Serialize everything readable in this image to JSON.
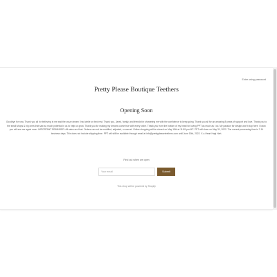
{
  "header": {
    "password_link": "Enter using password",
    "store_name": "Pretty Please Boutique Teethers"
  },
  "main": {
    "heading": "Opening Soon",
    "message": "Goodbye for now. Thank you all for believing in me and the crazy dream I had while on bed rest. Thank you, Jared, family, and friends for showering me with the confidence to keep going. Thank you all for an amazing 8 years of support and love. Thank you to the small shops & big ones that saw so much potential in us to help us grow. Thank you for making my dreams come true with every order. Thank you from the bottom of my heart for loving PPT as much as I do. My passion for design won't stop here. I know you will see me again soon. IMPORTANT REMINDER: All sales are final. Orders can not be modified, adjusted, or cancel. Online shopping will be closed on May 15th at 11:59 pm MT. PPT will close on May 31, 2022. The current processing time is 7-14 business days. This does not include shipping time. PPT will still be available through email at info@prettypleaseteethers.com until June 15th, 2022. X-o-Heart Hagi Hart."
  },
  "signup": {
    "prompt": "Find out when we open",
    "email_placeholder": "Your email",
    "submit_label": "Submit"
  },
  "footer": {
    "powered_by": "This shop will be powered by Shopify"
  },
  "colors": {
    "accent": "#7a5a2e",
    "text": "#2d2d2d"
  }
}
